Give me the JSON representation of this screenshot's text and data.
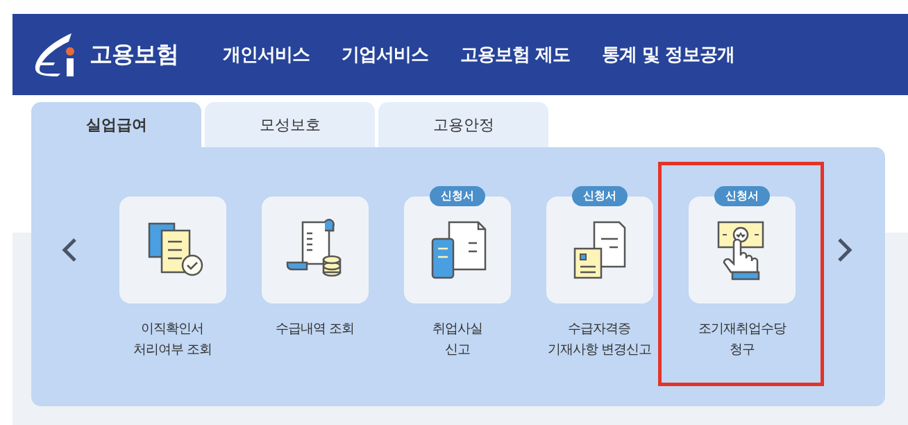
{
  "header": {
    "logo_text": "고용보험",
    "nav": [
      "개인서비스",
      "기업서비스",
      "고용보험 제도",
      "통계 및 정보공개"
    ]
  },
  "tabs": [
    {
      "label": "실업급여",
      "selected": true
    },
    {
      "label": "모성보호",
      "selected": false
    },
    {
      "label": "고용안정",
      "selected": false
    }
  ],
  "services": [
    {
      "kind": "document-check",
      "label": [
        "이직확인서",
        "처리여부 조회"
      ],
      "highlighted": false
    },
    {
      "kind": "receipt-coins",
      "label": [
        "수급내역 조회"
      ],
      "highlighted": false
    },
    {
      "kind": "phone-document",
      "badge": "신청서",
      "label": [
        "취업사실",
        "신고"
      ],
      "highlighted": false
    },
    {
      "kind": "id-document",
      "badge": "신청서",
      "label": [
        "수급자격증",
        "기재사항 변경신고"
      ],
      "highlighted": false
    },
    {
      "kind": "hand-money",
      "badge": "신청서",
      "label": [
        "조기재취업수당",
        "청구"
      ],
      "highlighted": true
    }
  ]
}
